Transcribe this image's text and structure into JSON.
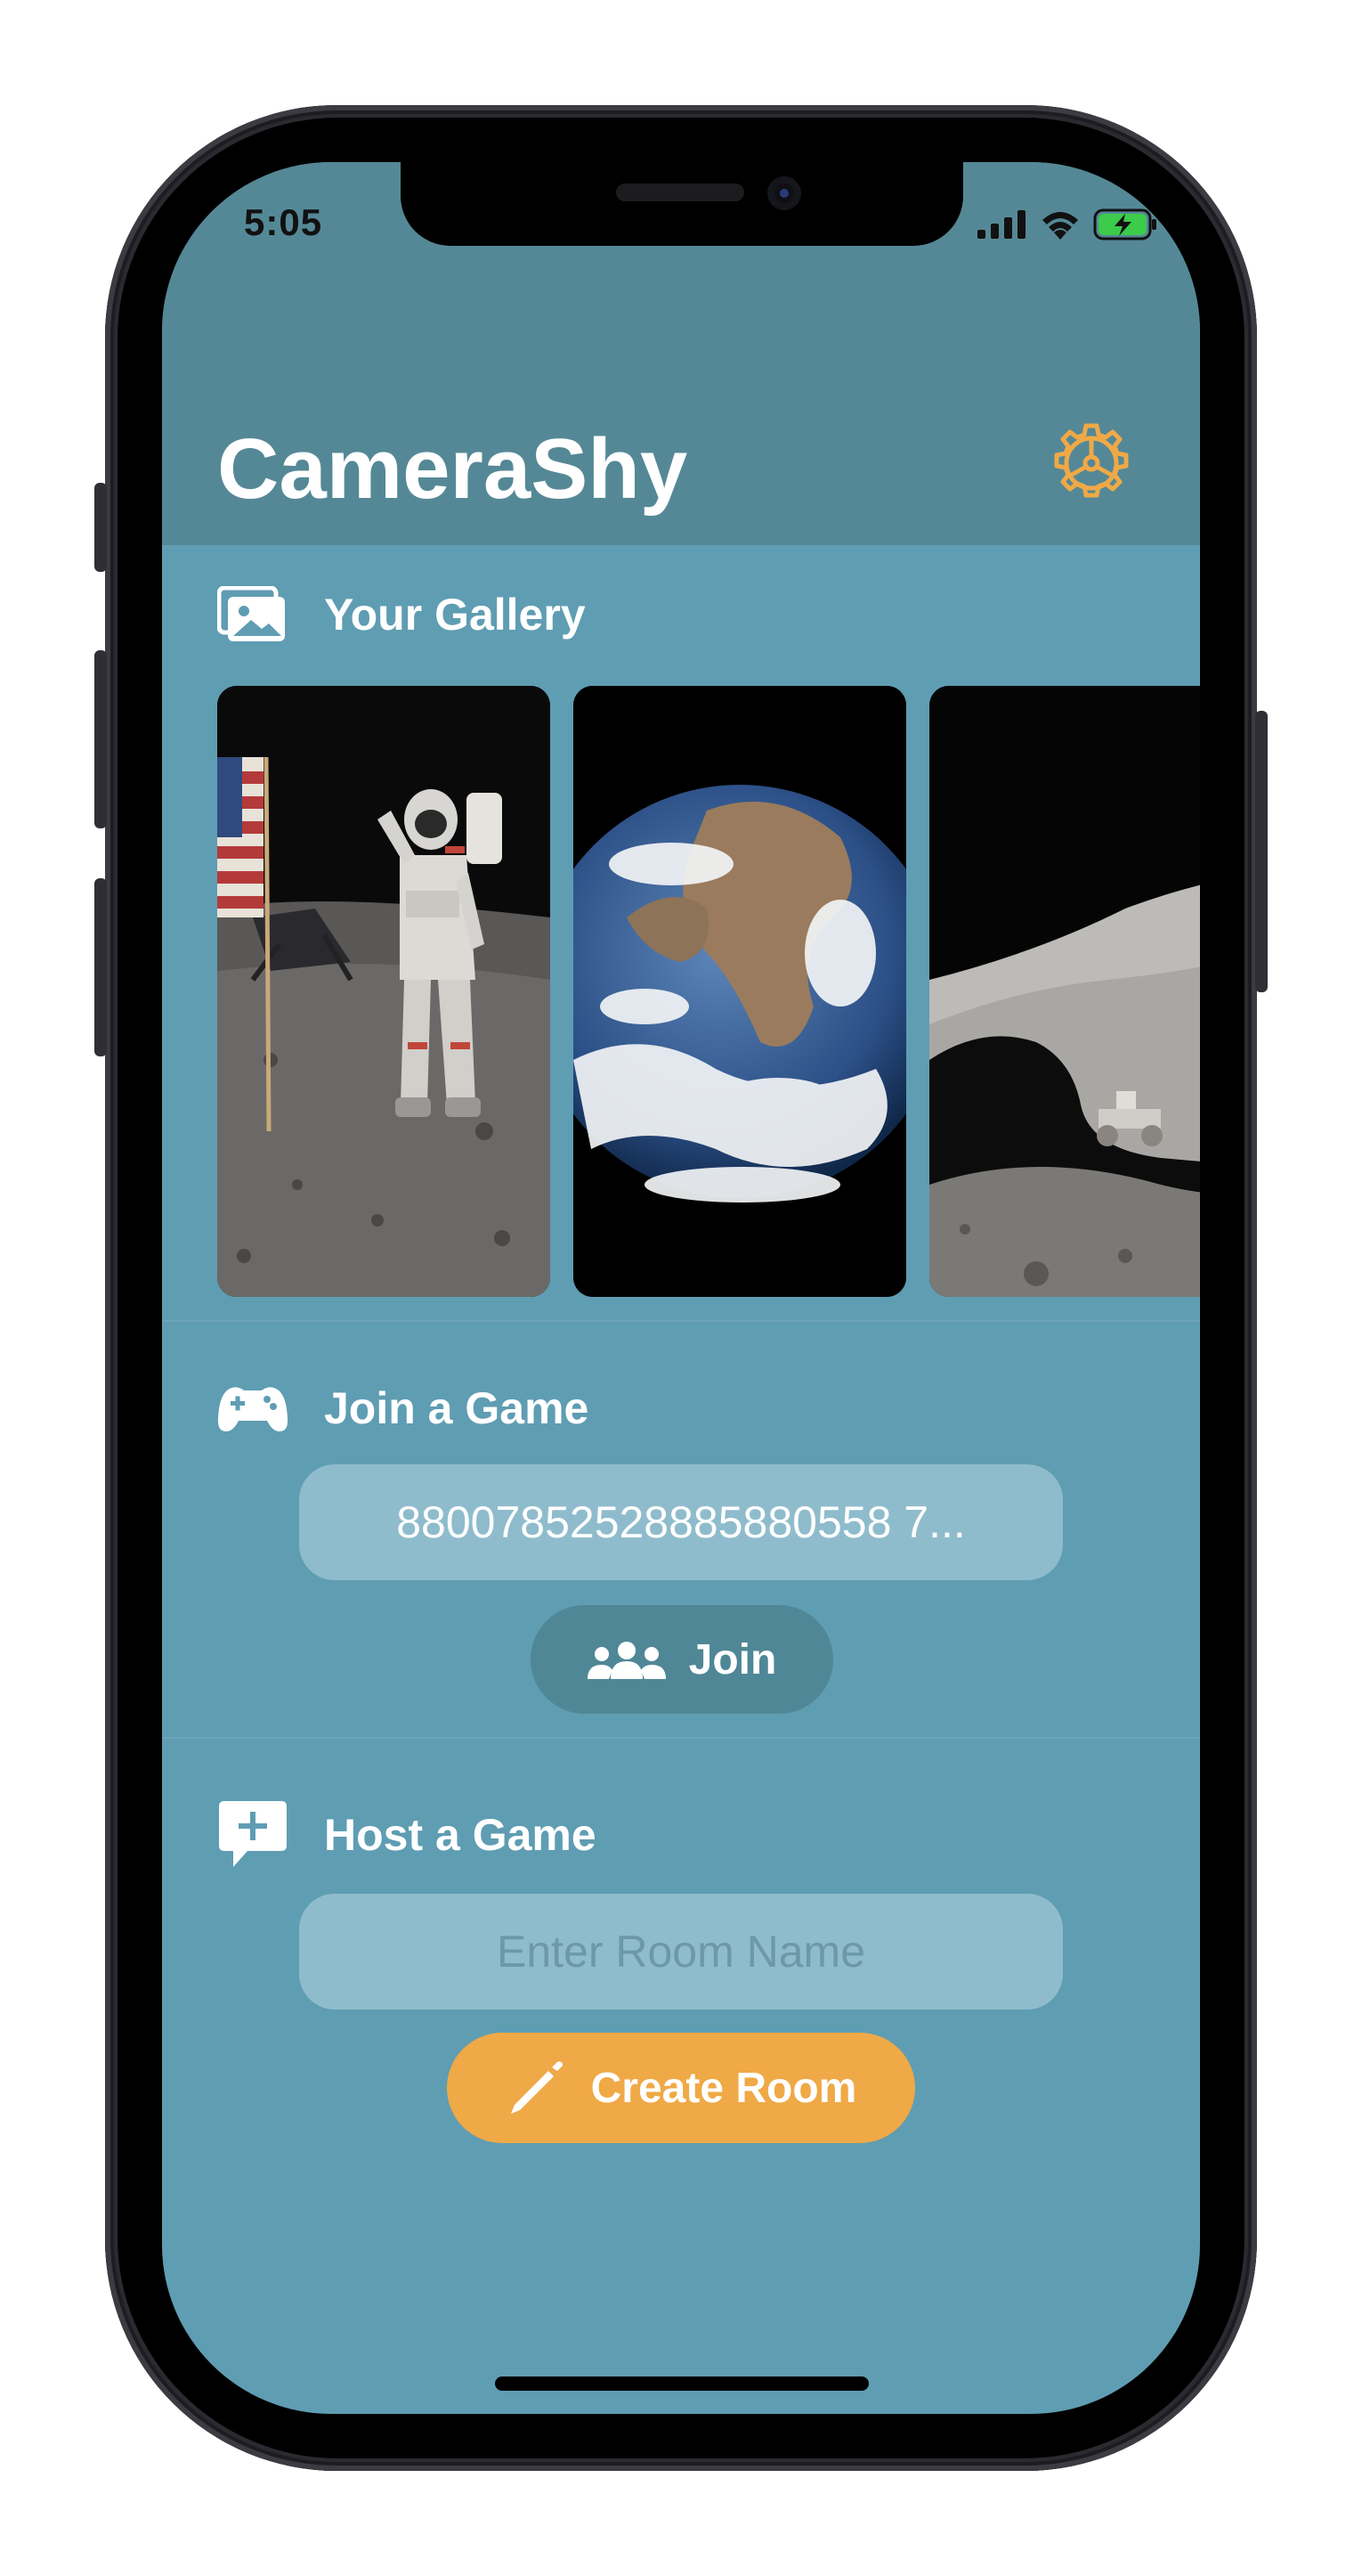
{
  "status": {
    "time": "5:05"
  },
  "app": {
    "title": "CameraShy"
  },
  "gallery": {
    "label": "Your Gallery",
    "photos": [
      "astronaut-on-moon",
      "earth-from-space",
      "moon-rover"
    ]
  },
  "join": {
    "label": "Join a Game",
    "code_value": "88007852528885880558 7...",
    "button_label": "Join"
  },
  "host": {
    "label": "Host a Game",
    "placeholder": "Enter Room Name",
    "button_label": "Create Room"
  },
  "colors": {
    "header_bg": "#558896",
    "screen_bg": "#5f9db3",
    "accent": "#efa946",
    "join_button": "#4f8796"
  }
}
